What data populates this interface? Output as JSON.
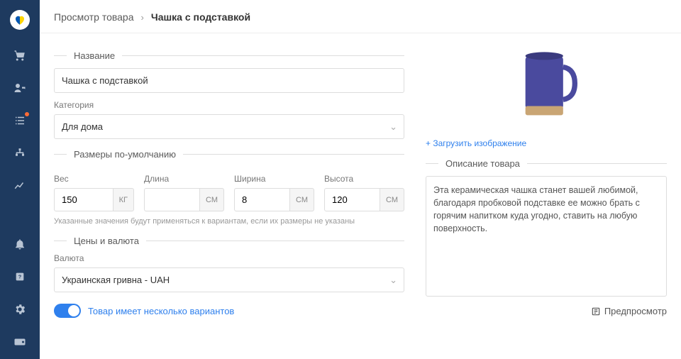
{
  "breadcrumb": {
    "root": "Просмотр товара",
    "current": "Чашка с подставкой"
  },
  "sections": {
    "name": "Название",
    "dimensions": "Размеры по-умолчанию",
    "prices": "Цены и валюта",
    "description": "Описание товара"
  },
  "labels": {
    "category": "Категория",
    "weight": "Вес",
    "length": "Длина",
    "width": "Ширина",
    "height": "Высота",
    "dim_hint": "Указанные значения будут применяться к вариантам, если их размеры не указаны",
    "currency": "Валюта",
    "has_variants": "Товар имеет несколько вариантов",
    "upload_image": "Загрузить изображение",
    "preview": "Предпросмотр"
  },
  "units": {
    "kg": "КГ",
    "cm": "СМ"
  },
  "form": {
    "name": "Чашка с подставкой",
    "category": "Для дома",
    "weight": "150",
    "length": "",
    "width": "8",
    "height": "120",
    "currency": "Украинская гривна - UAH",
    "description": "Эта керамическая чашка станет вашей любимой, благодаря пробковой подставке ее можно брать с горячим напитком куда угодно, ставить на любую поверхность."
  }
}
